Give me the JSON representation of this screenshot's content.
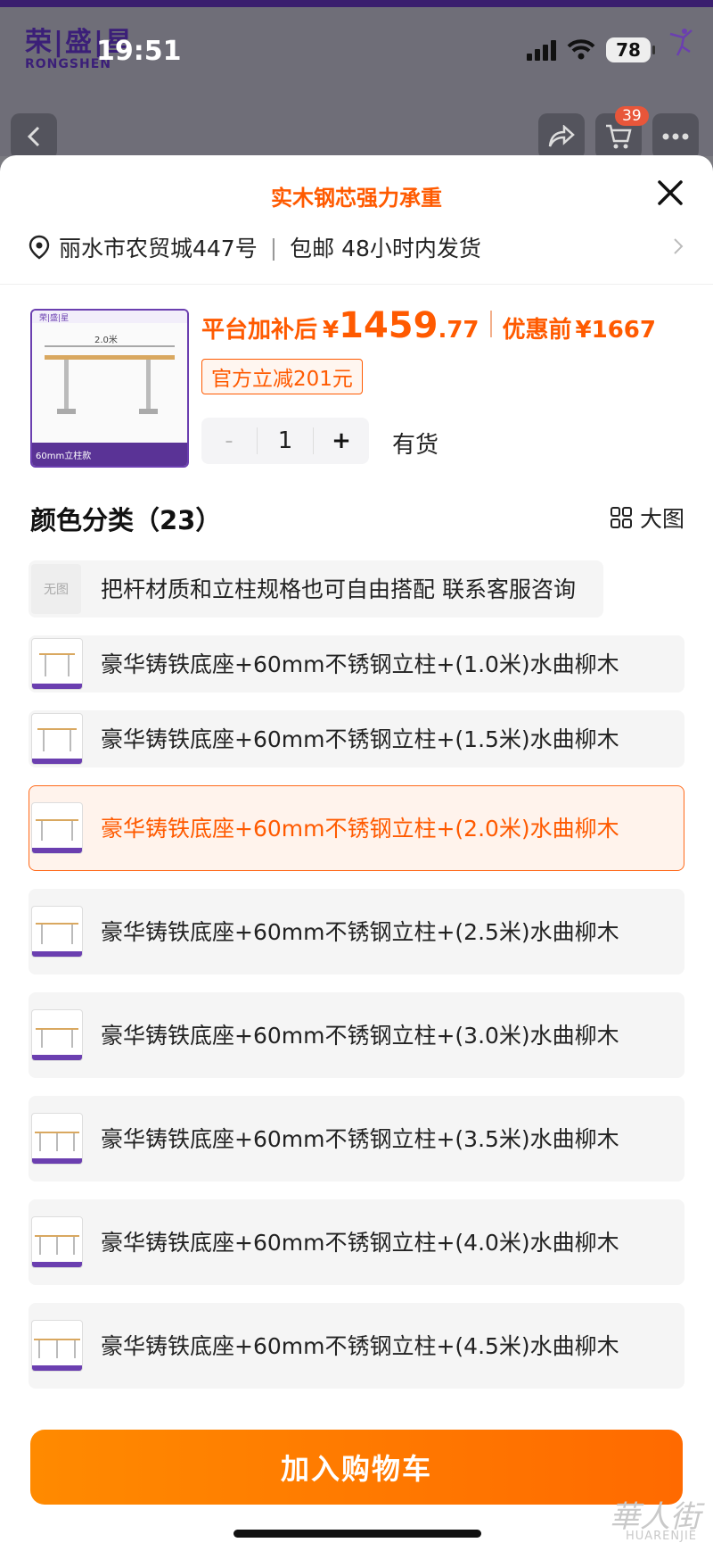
{
  "status_bar": {
    "time": "19:51",
    "battery": "78"
  },
  "background_page": {
    "brand_cn": "荣|盛|星",
    "brand_en": "RONGSHEN",
    "cart_count": "39"
  },
  "sheet": {
    "title": "实木钢芯强力承重",
    "address": "丽水市农贸城447号",
    "address_sep": "|",
    "shipping": "包邮 48小时内发货"
  },
  "product": {
    "price_label": "平台加补后",
    "currency": "¥",
    "price_int": "1459",
    "price_dec": ".77",
    "orig_label": "优惠前",
    "orig_price": "¥1667",
    "discount": "官方立减201元",
    "qty_minus": "-",
    "qty": "1",
    "qty_plus": "+",
    "stock": "有货"
  },
  "section": {
    "title": "颜色分类（23）",
    "bigview_label": "大图"
  },
  "options": [
    {
      "label": "把杆材质和立柱规格也可自由搭配 联系客服咨询",
      "noimg_text": "无图"
    },
    {
      "label": "豪华铸铁底座+60mm不锈钢立柱+(1.0米)水曲柳木"
    },
    {
      "label": "豪华铸铁底座+60mm不锈钢立柱+(1.5米)水曲柳木"
    },
    {
      "label": "豪华铸铁底座+60mm不锈钢立柱+(2.0米)水曲柳木"
    },
    {
      "label": "豪华铸铁底座+60mm不锈钢立柱+(2.5米)水曲柳木"
    },
    {
      "label": "豪华铸铁底座+60mm不锈钢立柱+(3.0米)水曲柳木"
    },
    {
      "label": "豪华铸铁底座+60mm不锈钢立柱+(3.5米)水曲柳木"
    },
    {
      "label": "豪华铸铁底座+60mm不锈钢立柱+(4.0米)水曲柳木"
    },
    {
      "label": "豪华铸铁底座+60mm不锈钢立柱+(4.5米)水曲柳木"
    }
  ],
  "thumb": {
    "length_label": "2.0米",
    "style_label": "60mm立柱款"
  },
  "add_to_cart": "加入购物车",
  "watermark": {
    "cn": "華人街",
    "en": "HUARENJIE"
  },
  "colors": {
    "accent": "#ff5a00",
    "brand_purple": "#6b3fb0"
  }
}
